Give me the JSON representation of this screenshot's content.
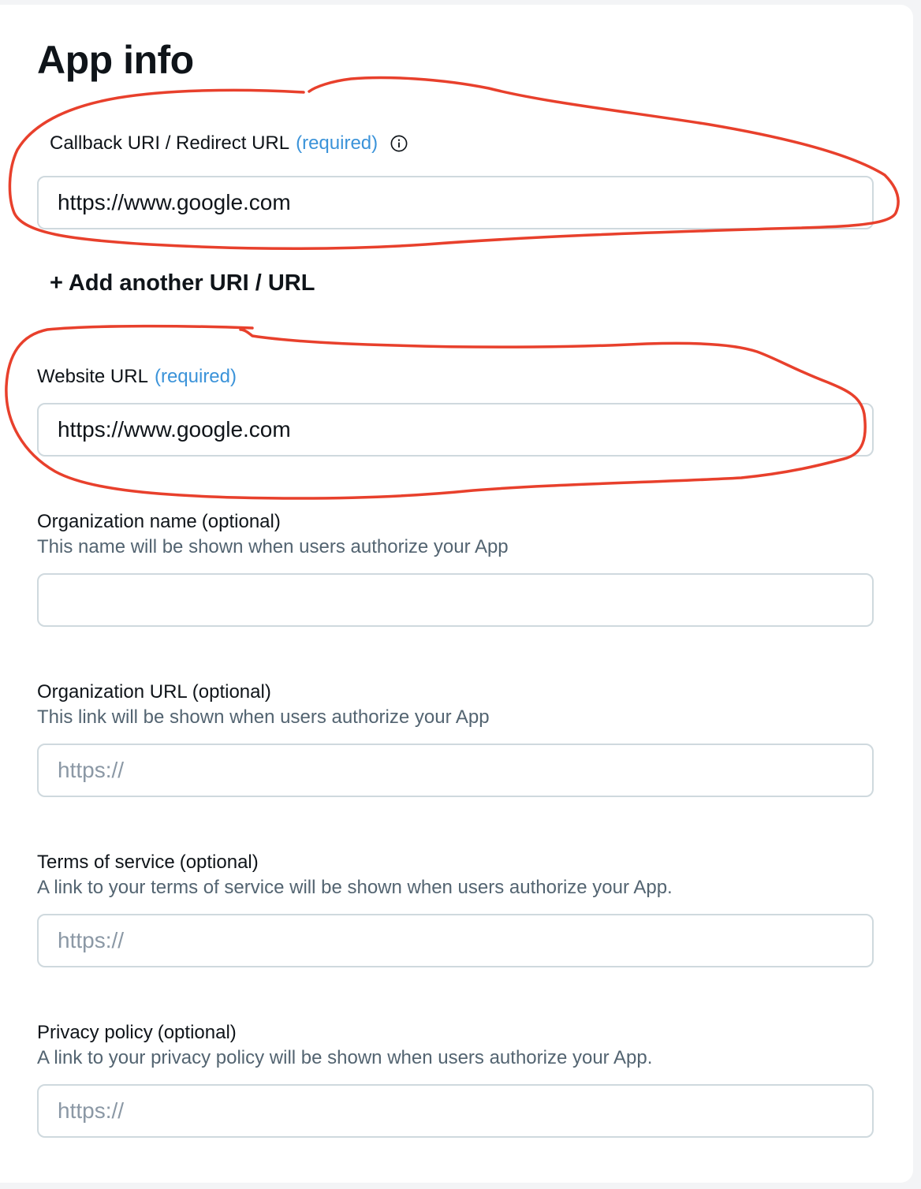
{
  "header": {
    "title": "App info"
  },
  "callback": {
    "label": "Callback URI / Redirect URL",
    "required": "(required)",
    "value": "https://www.google.com",
    "add_label": "+ Add another URI / URL"
  },
  "website": {
    "label": "Website URL",
    "required": "(required)",
    "value": "https://www.google.com"
  },
  "org_name": {
    "label": "Organization name",
    "optional": "(optional)",
    "hint": "This name will be shown when users authorize your App",
    "value": ""
  },
  "org_url": {
    "label": "Organization URL",
    "optional": "(optional)",
    "hint": "This link will be shown when users authorize your App",
    "placeholder": "https://"
  },
  "terms": {
    "label": "Terms of service",
    "optional": "(optional)",
    "hint": "A link to your terms of service will be shown when users authorize your App.",
    "placeholder": "https://"
  },
  "privacy": {
    "label": "Privacy policy",
    "optional": "(optional)",
    "hint": "A link to your privacy policy will be shown when users authorize your App.",
    "placeholder": "https://"
  },
  "icons": {
    "info": "info-icon"
  },
  "colors": {
    "required": "#3b93d9",
    "annotation": "#e8402c",
    "hint": "#536471",
    "border": "#cfd9de"
  }
}
